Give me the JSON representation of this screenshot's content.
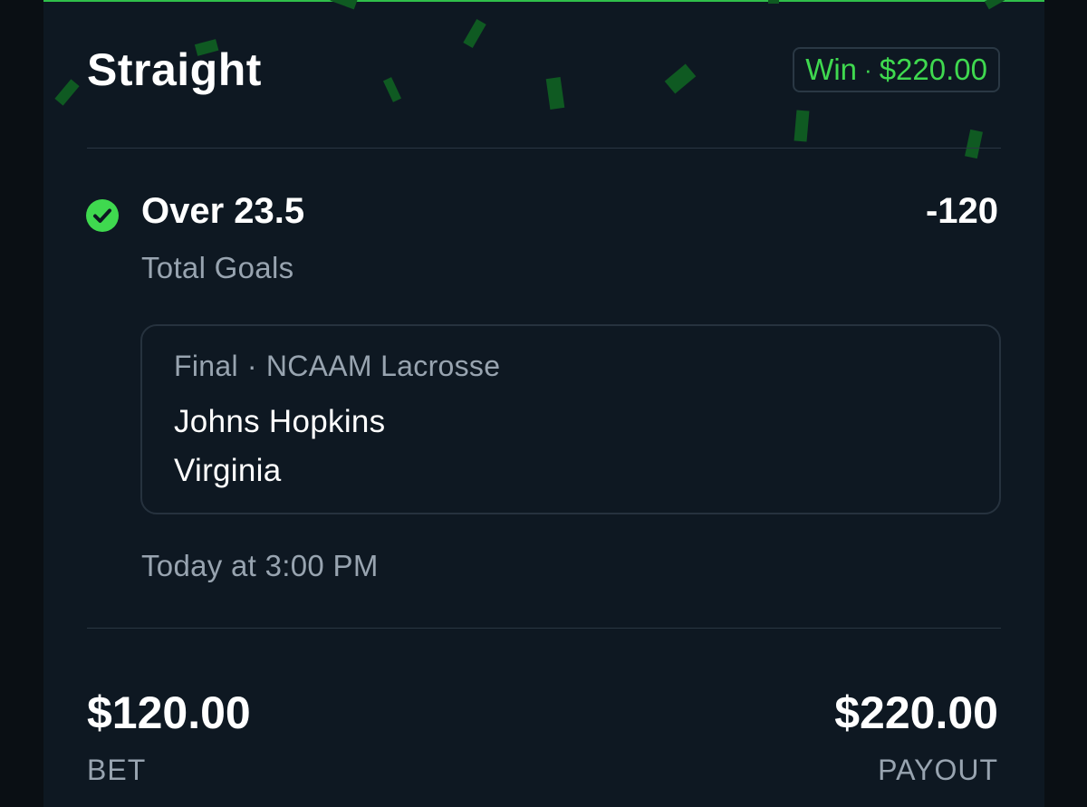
{
  "bet": {
    "type_title": "Straight",
    "result_label": "Win",
    "result_separator": "·",
    "result_amount": "$220.00",
    "selection": "Over 23.5",
    "odds": "-120",
    "market": "Total Goals",
    "status_icon": "check-circle-icon"
  },
  "event": {
    "status": "Final",
    "separator": "·",
    "league": "NCAAM Lacrosse",
    "team_1": "Johns Hopkins",
    "team_2": "Virginia",
    "time": "Today at 3:00 PM"
  },
  "summary": {
    "bet_amount": "$120.00",
    "bet_label": "BET",
    "payout_amount": "$220.00",
    "payout_label": "PAYOUT"
  },
  "colors": {
    "accent_win": "#3fd94f",
    "background": "#0e1822",
    "text_primary": "#ffffff",
    "text_secondary": "#98a4b0",
    "confetti": "#0f5a22"
  }
}
